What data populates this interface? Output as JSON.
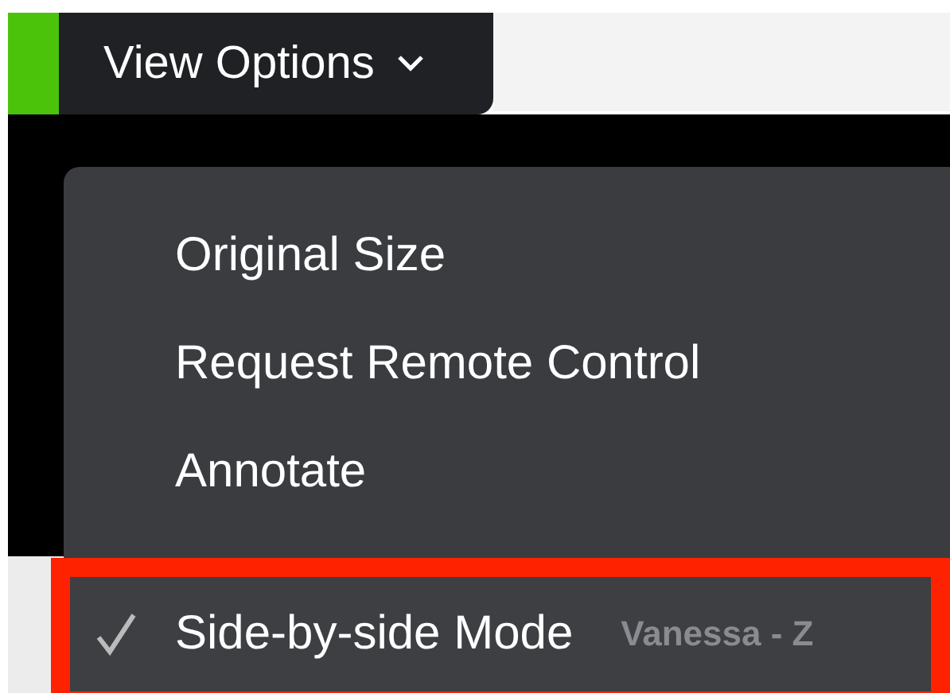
{
  "view_options_button": {
    "label": "View Options"
  },
  "menu": {
    "items": [
      {
        "label": "Original Size",
        "checked": false,
        "highlighted": false
      },
      {
        "label": "Request Remote Control",
        "checked": false,
        "highlighted": false
      },
      {
        "label": "Annotate",
        "checked": false,
        "highlighted": false
      },
      {
        "label": "Side-by-side Mode",
        "checked": true,
        "highlighted": true
      }
    ]
  },
  "background_label": "Vanessa - Z"
}
